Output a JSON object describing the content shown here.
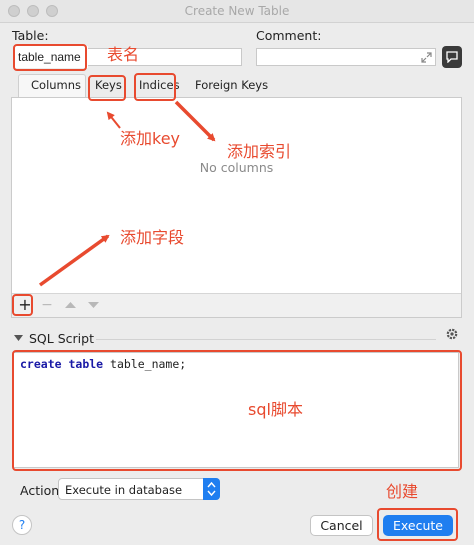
{
  "window": {
    "title": "Create New Table"
  },
  "form": {
    "table_label": "Table:",
    "table_value": "table_name",
    "comment_label": "Comment:",
    "comment_value": ""
  },
  "tabs": [
    {
      "label": "Columns",
      "active": true
    },
    {
      "label": "Keys",
      "active": false
    },
    {
      "label": "Indices",
      "active": false
    },
    {
      "label": "Foreign Keys",
      "active": false
    }
  ],
  "columns_panel": {
    "empty_text": "No columns"
  },
  "toolbar": {
    "add": "+",
    "remove": "−"
  },
  "sql": {
    "section_label": "SQL Script",
    "keyword1": "create",
    "keyword2": "table",
    "rest": " table_name;"
  },
  "action": {
    "label": "Action:",
    "selected": "Execute in database"
  },
  "buttons": {
    "help": "?",
    "cancel": "Cancel",
    "execute": "Execute"
  },
  "annotations": {
    "table_name": "表名",
    "add_key": "添加key",
    "add_index": "添加索引",
    "add_field": "添加字段",
    "sql_script": "sql脚本",
    "create": "创建"
  },
  "colors": {
    "annotation": "#e84a2f",
    "accent": "#1f7ef0",
    "keyword": "#1a1aa6"
  }
}
